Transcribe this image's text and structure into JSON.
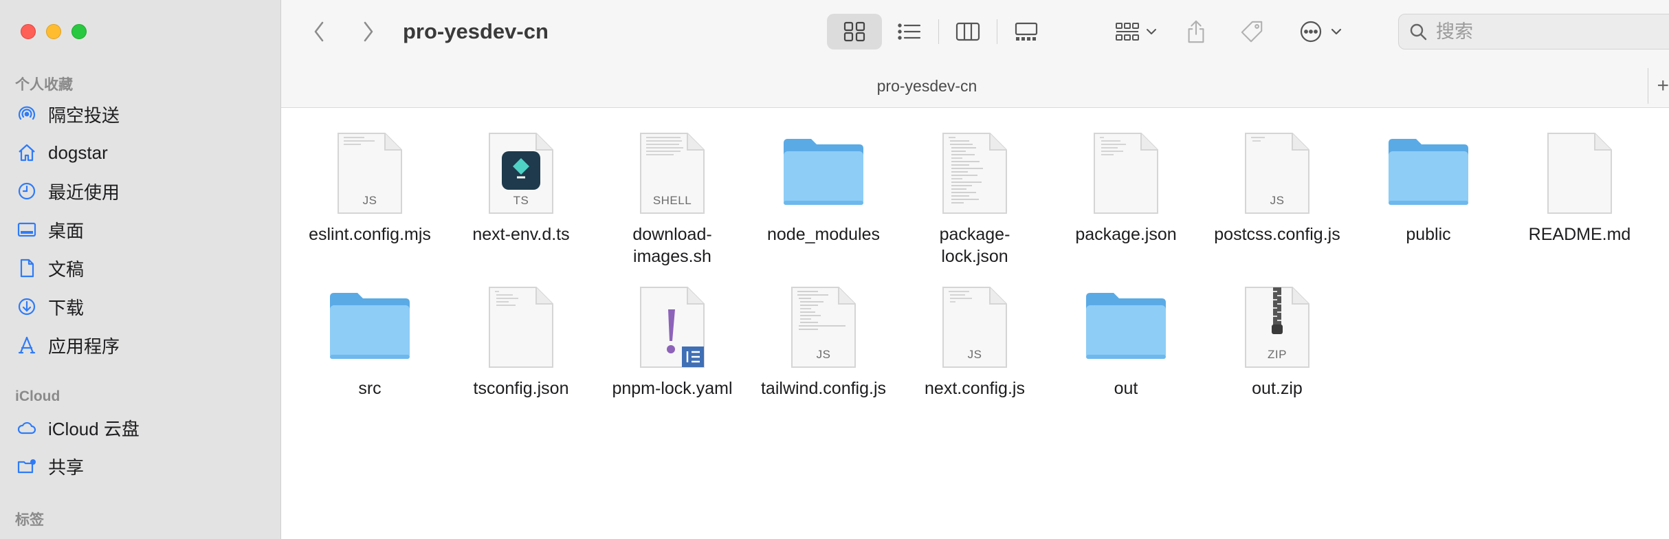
{
  "window": {
    "title": "pro-yesdev-cn",
    "path_title": "pro-yesdev-cn",
    "add_tab": "+"
  },
  "sidebar": {
    "sections": {
      "favorites": "个人收藏",
      "icloud": "iCloud",
      "tags": "标签"
    },
    "favorites": [
      {
        "label": "隔空投送",
        "icon": "airdrop-icon"
      },
      {
        "label": "dogstar",
        "icon": "home-icon"
      },
      {
        "label": "最近使用",
        "icon": "clock-icon"
      },
      {
        "label": "桌面",
        "icon": "desktop-icon"
      },
      {
        "label": "文稿",
        "icon": "document-icon"
      },
      {
        "label": "下载",
        "icon": "download-icon"
      },
      {
        "label": "应用程序",
        "icon": "applications-icon"
      }
    ],
    "icloud": [
      {
        "label": "iCloud 云盘",
        "icon": "cloud-icon"
      },
      {
        "label": "共享",
        "icon": "shared-folder-icon"
      }
    ]
  },
  "search": {
    "placeholder": "搜索"
  },
  "files": [
    {
      "name": "eslint.config.mjs",
      "kind": "doc",
      "ext": "JS"
    },
    {
      "name": "next-env.d.ts",
      "kind": "ts"
    },
    {
      "name": "download-\nimages.sh",
      "kind": "doc",
      "ext": "SHELL"
    },
    {
      "name": "node_modules",
      "kind": "folder"
    },
    {
      "name": "package-\nlock.json",
      "kind": "doc",
      "ext": ""
    },
    {
      "name": "package.json",
      "kind": "doc",
      "ext": ""
    },
    {
      "name": "postcss.config.js",
      "kind": "doc",
      "ext": "JS"
    },
    {
      "name": "public",
      "kind": "folder"
    },
    {
      "name": "README.md",
      "kind": "doc",
      "ext": ""
    },
    {
      "name": "src",
      "kind": "folder"
    },
    {
      "name": "tsconfig.json",
      "kind": "doc",
      "ext": ""
    },
    {
      "name": "pnpm-lock.yaml",
      "kind": "yaml"
    },
    {
      "name": "tailwind.config.js",
      "kind": "doc",
      "ext": "JS"
    },
    {
      "name": "next.config.js",
      "kind": "doc",
      "ext": "JS"
    },
    {
      "name": "out",
      "kind": "folder"
    },
    {
      "name": "out.zip",
      "kind": "zip",
      "ext": "ZIP"
    }
  ],
  "colors": {
    "accent": "#2f7bf6",
    "folder": "#8ecdf6",
    "folder_dark": "#5aaae6"
  }
}
